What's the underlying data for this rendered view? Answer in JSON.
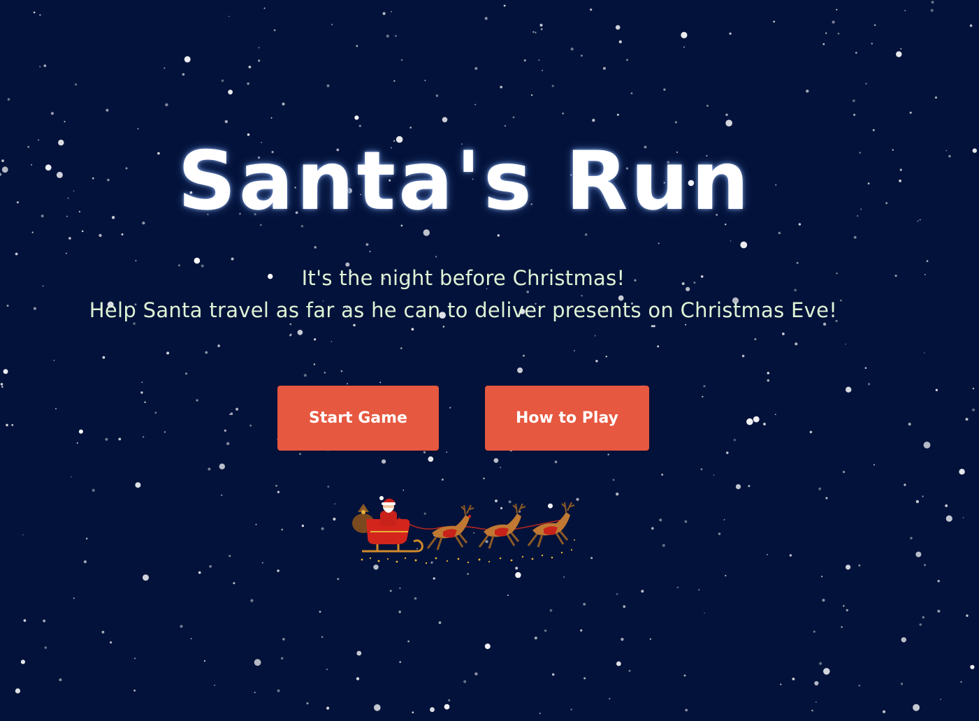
{
  "title": "Santa's Run",
  "intro": {
    "line1": "It's the night before Christmas!",
    "line2": "Help Santa travel as far as he can to deliver presents on Christmas Eve!"
  },
  "buttons": {
    "start": "Start Game",
    "how_to_play": "How to Play"
  },
  "colors": {
    "background": "#03123a",
    "button": "#e65840",
    "title_text": "#ffffff",
    "intro_text": "#dff3d6"
  },
  "icons": [
    "santa-sleigh-illustration",
    "reindeer-icon"
  ]
}
